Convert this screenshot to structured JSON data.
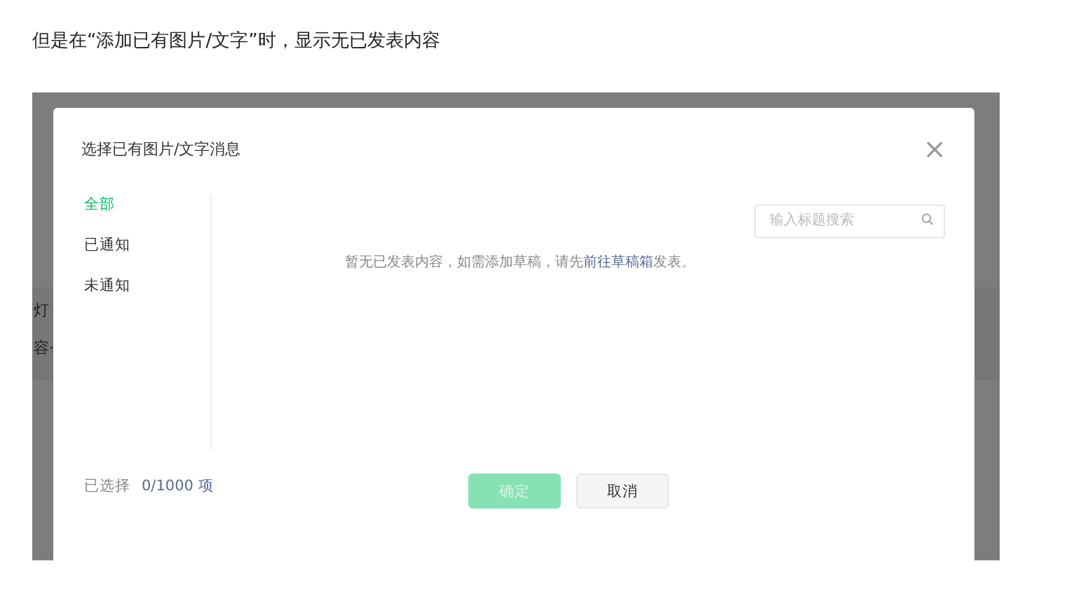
{
  "caption": "但是在“添加已有图片/文字”时，显示无已发表内容",
  "background_page": {
    "fragments": [
      "灯",
      "容·"
    ]
  },
  "dialog": {
    "title": "选择已有图片/文字消息",
    "close": "×",
    "nav": [
      {
        "label": "全部",
        "selected": true
      },
      {
        "label": "已通知",
        "selected": false
      },
      {
        "label": "未通知",
        "selected": false
      }
    ],
    "search": {
      "placeholder": "输入标题搜索"
    },
    "empty_message": {
      "before": "暂无已发表内容，如需添加草稿，请先",
      "link": "前往草稿箱",
      "after": "发表。"
    },
    "selection": {
      "label": "已选择",
      "count": "0/1000 项"
    },
    "buttons": [
      {
        "label": "确定",
        "kind": "primary",
        "disabled": true
      },
      {
        "label": "取消",
        "kind": "secondary",
        "disabled": false
      }
    ]
  }
}
